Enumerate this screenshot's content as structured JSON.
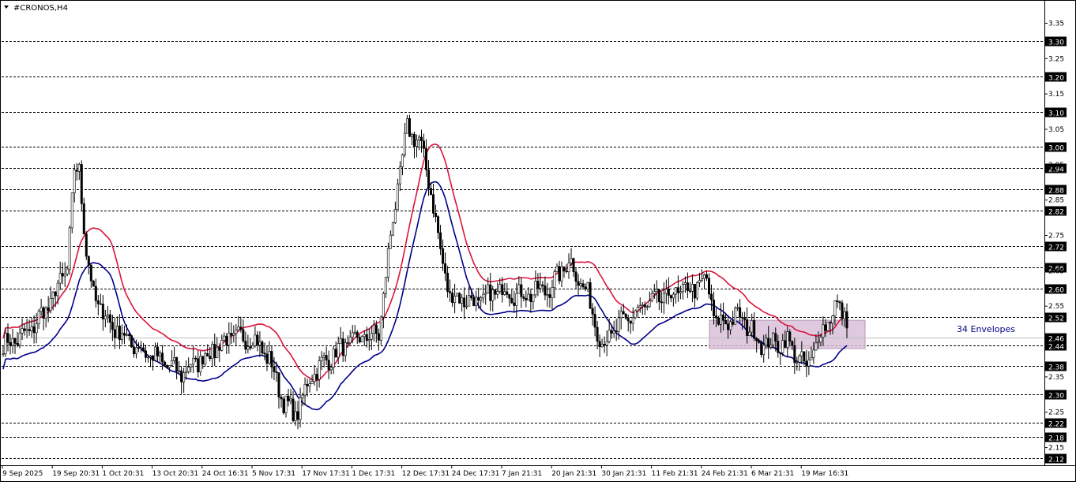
{
  "chart_data": {
    "type": "candlestick",
    "title": "#CRONOS,H4",
    "indicator_label": "34 Envelopes",
    "current_price_label": "2.46",
    "ylim": [
      2.1,
      3.38
    ],
    "y_ticks": [
      "3.35",
      "3.25",
      "3.15",
      "3.05",
      "2.95",
      "2.85",
      "2.75",
      "2.65",
      "2.55",
      "2.45",
      "2.35",
      "2.25",
      "2.15"
    ],
    "levels": [
      "3.30",
      "3.20",
      "3.10",
      "3.00",
      "2.94",
      "2.88",
      "2.82",
      "2.72",
      "2.66",
      "2.60",
      "2.52",
      "2.44",
      "2.38",
      "2.30",
      "2.22",
      "2.18",
      "2.12"
    ],
    "x_labels": [
      "9 Sep 2025",
      "19 Sep 20:31",
      "1 Oct 20:31",
      "13 Oct 20:31",
      "24 Oct 16:31",
      "5 Nov 17:31",
      "17 Nov 17:31",
      "1 Dec 17:31",
      "12 Dec 17:31",
      "24 Dec 17:31",
      "7 Jan 21:31",
      "20 Jan 21:31",
      "30 Jan 21:31",
      "11 Feb 21:31",
      "24 Feb 21:31",
      "6 Mar 21:31",
      "19 Mar 16:31"
    ],
    "anchors": [
      [
        0,
        2.44
      ],
      [
        10,
        2.47
      ],
      [
        20,
        2.56
      ],
      [
        27,
        2.66
      ],
      [
        30,
        2.93
      ],
      [
        32,
        2.94
      ],
      [
        35,
        2.7
      ],
      [
        38,
        2.58
      ],
      [
        45,
        2.5
      ],
      [
        55,
        2.44
      ],
      [
        65,
        2.4
      ],
      [
        75,
        2.36
      ],
      [
        85,
        2.41
      ],
      [
        95,
        2.46
      ],
      [
        105,
        2.46
      ],
      [
        112,
        2.4
      ],
      [
        118,
        2.28
      ],
      [
        123,
        2.24
      ],
      [
        130,
        2.36
      ],
      [
        140,
        2.42
      ],
      [
        150,
        2.46
      ],
      [
        158,
        2.47
      ],
      [
        164,
        2.8
      ],
      [
        170,
        3.05
      ],
      [
        175,
        3.02
      ],
      [
        180,
        2.88
      ],
      [
        184,
        2.7
      ],
      [
        188,
        2.58
      ],
      [
        200,
        2.56
      ],
      [
        210,
        2.6
      ],
      [
        218,
        2.58
      ],
      [
        230,
        2.6
      ],
      [
        238,
        2.68
      ],
      [
        246,
        2.58
      ],
      [
        252,
        2.44
      ],
      [
        260,
        2.5
      ],
      [
        270,
        2.55
      ],
      [
        280,
        2.58
      ],
      [
        290,
        2.6
      ],
      [
        296,
        2.62
      ],
      [
        300,
        2.5
      ],
      [
        310,
        2.52
      ],
      [
        320,
        2.44
      ],
      [
        330,
        2.45
      ],
      [
        338,
        2.37
      ],
      [
        343,
        2.46
      ],
      [
        350,
        2.55
      ],
      [
        355,
        2.52
      ]
    ],
    "envelope_upper_end": 2.51,
    "envelope_lower_end": 2.46,
    "colors": {
      "background": "#ffffff",
      "candle": "#000000",
      "upper_envelope": "#dc143c",
      "lower_envelope": "#00008b",
      "grid": "#000000",
      "box_fill": "#d8bfd8",
      "label_bg": "#000000",
      "label_text": "#ffffff",
      "indicator_text": "#00008b"
    }
  }
}
